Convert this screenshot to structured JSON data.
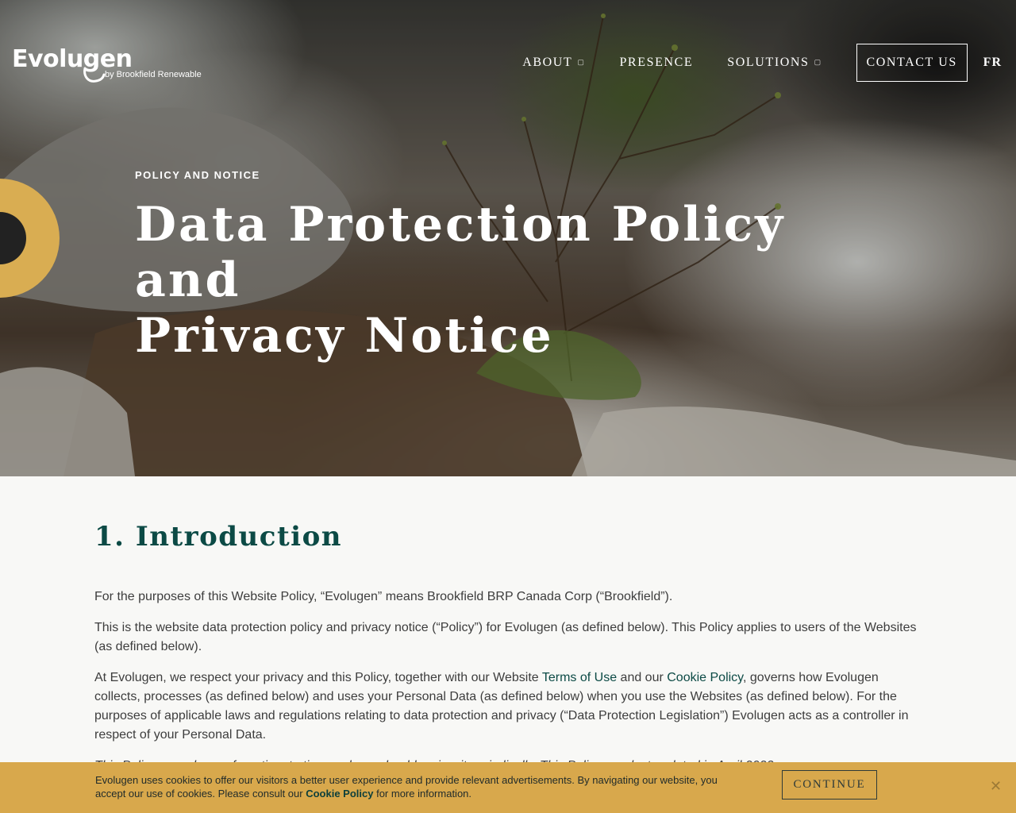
{
  "brand": {
    "logo_word": "Evolugen",
    "logo_sub": "by Brookfield Renewable"
  },
  "nav": {
    "items": [
      {
        "label": "ABOUT",
        "has_dropdown": true
      },
      {
        "label": "PRESENCE",
        "has_dropdown": false
      },
      {
        "label": "SOLUTIONS",
        "has_dropdown": true
      }
    ],
    "contact_label": "CONTACT US",
    "language_label": "FR"
  },
  "hero": {
    "eyebrow": "POLICY AND NOTICE",
    "title_line1": "Data Protection Policy and",
    "title_line2": "Privacy Notice"
  },
  "content": {
    "heading": "1. Introduction",
    "p1": "For the purposes of this Website Policy, “Evolugen” means Brookfield BRP Canada Corp (“Brookfield”).",
    "p2": "This is the website data protection policy and privacy notice (“Policy”) for Evolugen (as defined below). This Policy applies to users of the Websites (as defined below).",
    "p3_a": "At Evolugen, we respect your privacy and this Policy, together with our Website ",
    "p3_link1": "Terms of Use",
    "p3_b": " and our ",
    "p3_link2": "Cookie Policy",
    "p3_c": ", governs how Evolugen collects, processes (as defined below) and uses your Personal Data (as defined below) when you use the Websites (as defined below). For the purposes of applicable laws and regulations relating to data protection and privacy (“Data Protection Legislation”) Evolugen acts as a controller in respect of your Personal Data.",
    "p4": "This Policy may change from time to time and you should review it periodically. This Policy was last updated in April 2023."
  },
  "cookie_bar": {
    "text_a": "Evolugen uses cookies to offer our visitors a better user experience and provide relevant advertisements. By navigating our website, you accept our use of cookies. Please consult our ",
    "link": "Cookie Policy",
    "text_b": " for more information.",
    "continue_label": "CONTINUE",
    "close_glyph": "✕"
  },
  "colors": {
    "accent_teal": "#0c4a45",
    "accent_gold": "#d9ad52",
    "cookie_bar_bg": "#d8a84c"
  }
}
